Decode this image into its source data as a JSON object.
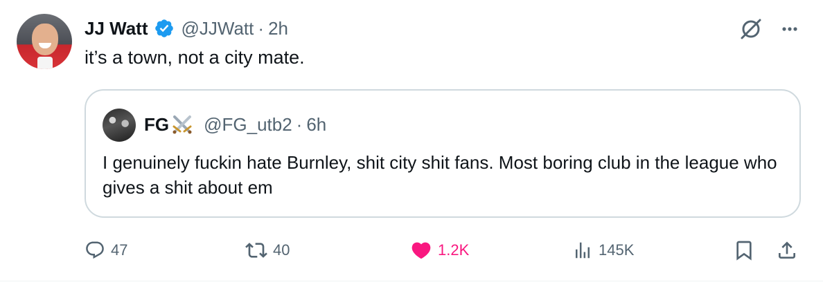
{
  "author": {
    "display_name": "JJ Watt",
    "handle": "@JJWatt",
    "time": "2h",
    "verified": true
  },
  "separator": "·",
  "tweet_text": "it’s a town, not a city mate.",
  "quoted": {
    "display_name": "FG",
    "emoji_icon": "crossed-swords-icon",
    "handle": "@FG_utb2",
    "time": "6h",
    "text": "I genuinely fuckin hate Burnley, shit city shit fans. Most boring club in the league who gives a shit about em"
  },
  "actions": {
    "replies": "47",
    "reposts": "40",
    "likes": "1.2K",
    "views": "145K"
  },
  "colors": {
    "verified_blue": "#1d9bf0",
    "like_pink": "#f91880",
    "secondary_text": "#536471",
    "border": "#cfd9de"
  }
}
